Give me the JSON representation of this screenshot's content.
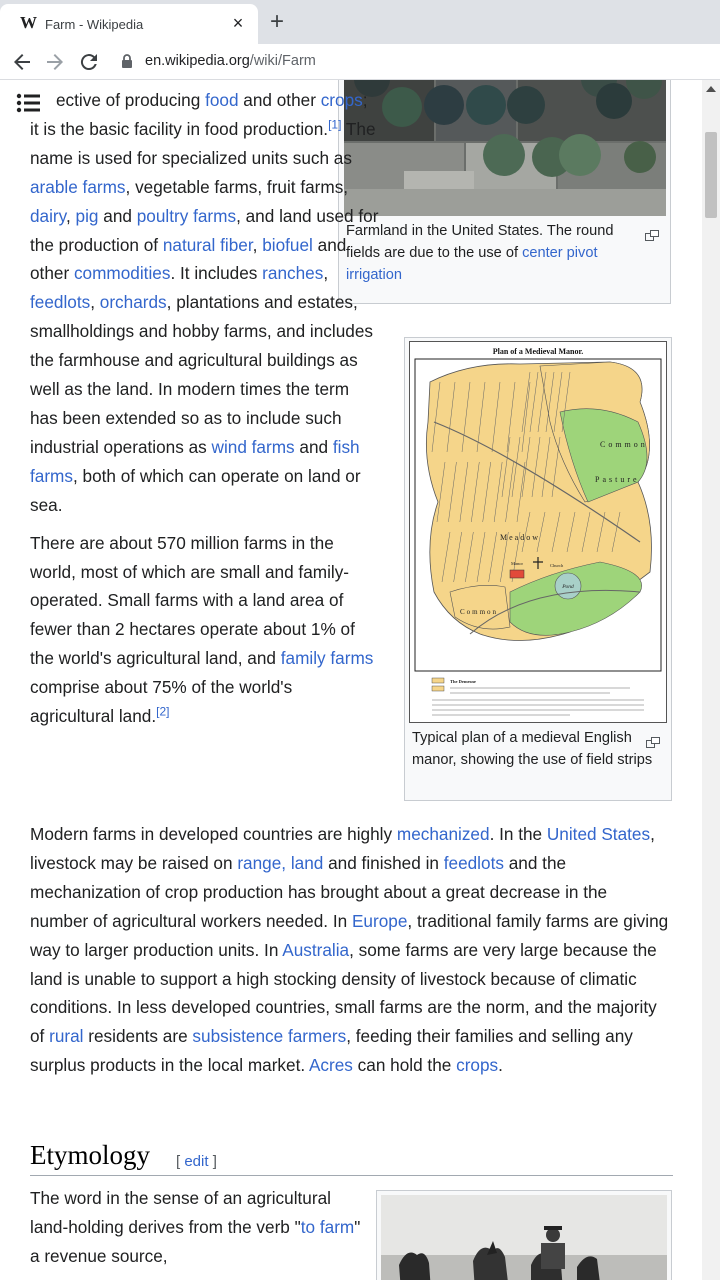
{
  "browser": {
    "tab_title": "Farm - Wikipedia",
    "favicon": "W",
    "close_glyph": "×",
    "new_tab_glyph": "+",
    "url_domain": "en.wikipedia.org",
    "url_path": "/wiki/Farm"
  },
  "icons": [
    "back-icon",
    "forward-icon",
    "reload-icon",
    "lock-icon",
    "menu-icon",
    "enlarge-icon",
    "close-icon",
    "plus-icon"
  ],
  "colors": {
    "link": "#3366cc",
    "text": "#202122",
    "tabbar": "#dee1e6",
    "field_green": "#9ed47a",
    "field_yellow": "#f5d58a"
  },
  "lead": {
    "p1": {
      "t1": "ective of producing ",
      "l_food": "food",
      "t2": " and other ",
      "l_crops": "crops",
      "t3": "; it is the basic facility in food production.",
      "ref1": "[1]",
      "t4": " The name is used for specialized units such as ",
      "l_arable": "arable farms",
      "t5": ", vegetable farms, fruit farms, ",
      "l_dairy": "dairy",
      "t6": ", ",
      "l_pig": "pig",
      "t7": " and ",
      "l_poultry": "poultry farms",
      "t8": ", and land used for the production of ",
      "l_fiber": "natural fiber",
      "t9": ", ",
      "l_biofuel": "biofuel",
      "t10": " and other ",
      "l_commodities": "commodities",
      "t11": ". It includes ",
      "l_ranches": "ranches",
      "t12": ", ",
      "l_feedlots": "feedlots",
      "t13": ", ",
      "l_orchards": "orchards",
      "t14": ", plantations and estates, smallholdings and hobby farms, and includes the farmhouse and agricultural buildings as well as the land. In modern times the term has been extended so as to include such industrial operations as ",
      "l_wind": "wind farms",
      "t15": " and ",
      "l_fish": "fish farms",
      "t16": ", both of which can operate on land or sea."
    },
    "p2": {
      "t1": "There are about 570 million farms in the world, most of which are small and family-operated. Small farms with a land area of fewer than 2 hectares operate about 1% of the world's agricultural land, and ",
      "l_family": "family farms",
      "t2": " comprise about 75% of the world's agricultural land.",
      "ref2": "[2]"
    },
    "p3": {
      "t1": "Modern farms in developed countries are highly ",
      "l_mech": "mechanized",
      "t2": ". In the ",
      "l_us": "United States",
      "t3": ", livestock may be raised on ",
      "l_range": "range, land",
      "t4": " and finished in ",
      "l_feedlots": "feedlots",
      "t5": " and the mechanization of crop production has brought about a great decrease in the number of agricultural workers needed. In ",
      "l_europe": "Europe",
      "t6": ", traditional family farms are giving way to larger production units. In ",
      "l_australia": "Australia",
      "t7": ", some farms are very large because the land is unable to support a high stocking density of livestock because of climatic conditions. In less developed countries, small farms are the norm, and the majority of ",
      "l_rural": "rural",
      "t8": " residents are ",
      "l_subsistence": "subsistence farmers",
      "t9": ", feeding their families and selling any surplus products in the local market. ",
      "l_acres": "Acres",
      "t10": " can hold the ",
      "l_crops": "crops",
      "t11": "."
    }
  },
  "figure1": {
    "caption_t1": "Farmland in the United States. The round fields are due to the use of ",
    "caption_link": "center pivot irrigation"
  },
  "figure2": {
    "map_title": "Plan of a Medieval Manor.",
    "map_labels": {
      "common": "Common",
      "pasture": "Pasture",
      "pond": "Pond",
      "manor": "Manor",
      "church": "Church",
      "meadow": "Meadow",
      "common_lower": "Common"
    },
    "legend_title": "The Demesne",
    "caption": "Typical plan of a medieval English manor, showing the use of field strips"
  },
  "etymology": {
    "heading": "Etymology",
    "edit_open": "[ ",
    "edit_label": "edit",
    "edit_close": " ]",
    "p1": {
      "t1": "The word in the sense of an agricultural land-holding derives from the verb \"",
      "l_tofarm": "to farm",
      "t2": "\" a revenue source,"
    }
  }
}
